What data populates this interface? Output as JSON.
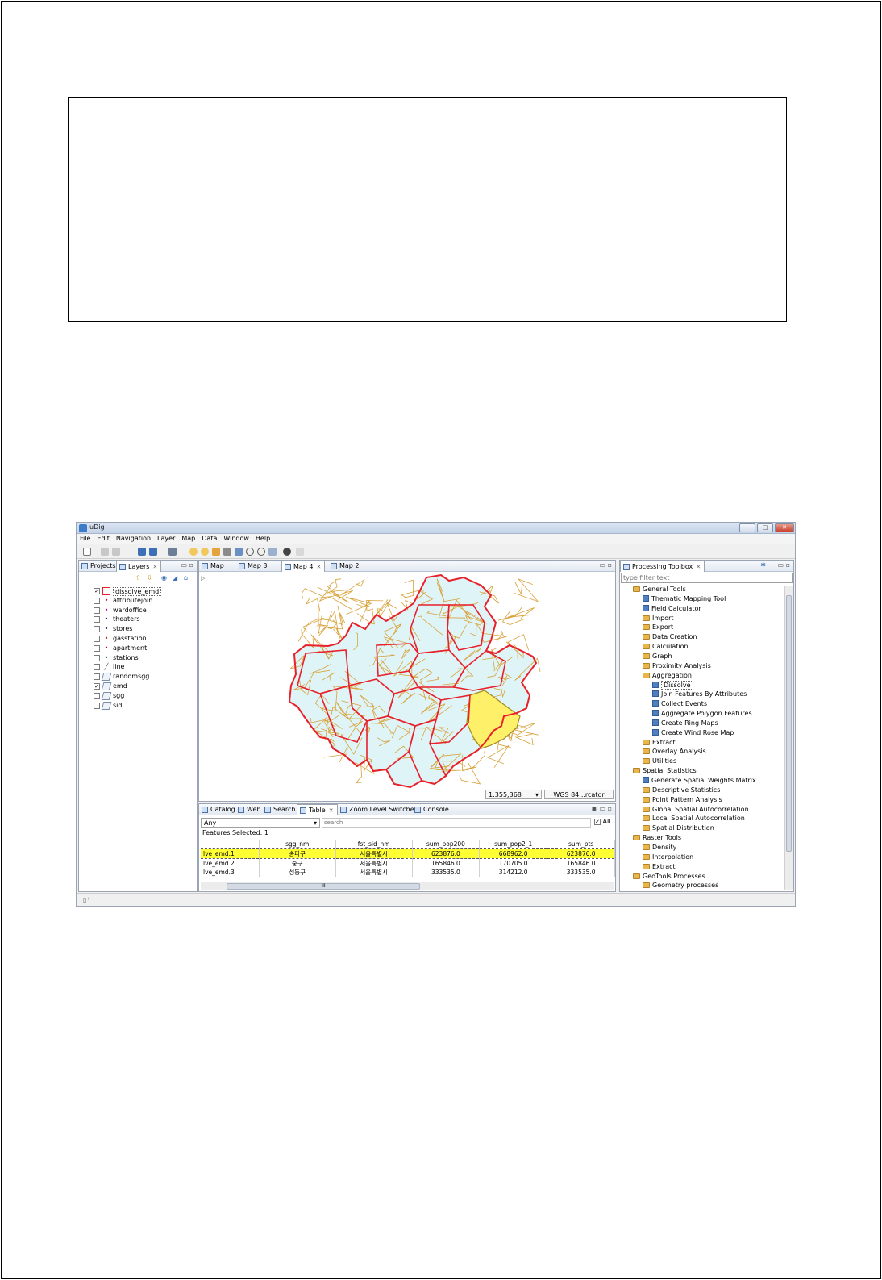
{
  "window": {
    "title": "uDig",
    "minimize": "─",
    "maximize": "□",
    "close": "✕"
  },
  "menu": [
    "File",
    "Edit",
    "Navigation",
    "Layer",
    "Map",
    "Data",
    "Window",
    "Help"
  ],
  "left_panel": {
    "tabs": [
      {
        "label": "Projects",
        "icon": "projects-icon"
      },
      {
        "label": "Layers",
        "icon": "layers-icon"
      }
    ],
    "layers": [
      {
        "name": "dissolve_emd",
        "checked": true,
        "symbol": "polygon-red-icon"
      },
      {
        "name": "attributejoin",
        "checked": false,
        "symbol": "point-icon"
      },
      {
        "name": "wardoffice",
        "checked": false,
        "symbol": "point-icon"
      },
      {
        "name": "theaters",
        "checked": false,
        "symbol": "point-icon"
      },
      {
        "name": "stores",
        "checked": false,
        "symbol": "point-icon"
      },
      {
        "name": "gasstation",
        "checked": false,
        "symbol": "point-icon"
      },
      {
        "name": "apartment",
        "checked": false,
        "symbol": "point-icon"
      },
      {
        "name": "stations",
        "checked": false,
        "symbol": "point-icon"
      },
      {
        "name": "line",
        "checked": false,
        "symbol": "line-icon"
      },
      {
        "name": "randomsgg",
        "checked": false,
        "symbol": "polygon-icon"
      },
      {
        "name": "emd",
        "checked": true,
        "symbol": "polygon-icon"
      },
      {
        "name": "sgg",
        "checked": false,
        "symbol": "polygon-icon"
      },
      {
        "name": "sid",
        "checked": false,
        "symbol": "polygon-icon"
      }
    ]
  },
  "map_editor": {
    "tabs": [
      "Map",
      "Map 3",
      "Map 4",
      "Map 2"
    ],
    "active_tab": "Map 4",
    "scale": "1:355,368",
    "crs": "WGS 84...rcator"
  },
  "bottom_panel": {
    "tabs": [
      "Catalog",
      "Web",
      "Search",
      "Table",
      "Zoom Level Switcher",
      "Console"
    ],
    "active_tab": "Table",
    "filter_select": "Any",
    "search_placeholder": "search",
    "all_label": "All",
    "features_selected": "Features Selected: 1",
    "columns": [
      "",
      "sgg_nm",
      "fst_sid_nm",
      "sum_pop200",
      "sum_pop2_1",
      "sum_pts"
    ],
    "rows": [
      [
        "lve_emd.1",
        "송파구",
        "서울특별시",
        "623876.0",
        "668962.0",
        "623876.0"
      ],
      [
        "lve_emd.2",
        "중구",
        "서울특별시",
        "165846.0",
        "170705.0",
        "165846.0"
      ],
      [
        "lve_emd.3",
        "성동구",
        "서울특별시",
        "333535.0",
        "314212.0",
        "333535.0"
      ]
    ],
    "selected_row": 0,
    "scroll_label": "III"
  },
  "toolbox": {
    "title": "Processing Toolbox",
    "filter_placeholder": "type filter text",
    "items": [
      {
        "label": "General Tools",
        "kind": "folder",
        "level": 1
      },
      {
        "label": "Thematic Mapping Tool",
        "kind": "tool",
        "level": 2
      },
      {
        "label": "Field Calculator",
        "kind": "tool",
        "level": 2
      },
      {
        "label": "Import",
        "kind": "folder",
        "level": 2
      },
      {
        "label": "Export",
        "kind": "folder",
        "level": 2
      },
      {
        "label": "Data Creation",
        "kind": "folder",
        "level": 2
      },
      {
        "label": "Calculation",
        "kind": "folder",
        "level": 2
      },
      {
        "label": "Graph",
        "kind": "folder",
        "level": 2
      },
      {
        "label": "Proximity Analysis",
        "kind": "folder",
        "level": 2
      },
      {
        "label": "Aggregation",
        "kind": "folder",
        "level": 2
      },
      {
        "label": "Dissolve",
        "kind": "tool",
        "level": 3
      },
      {
        "label": "Join Features By Attributes",
        "kind": "tool",
        "level": 3
      },
      {
        "label": "Collect Events",
        "kind": "tool",
        "level": 3
      },
      {
        "label": "Aggregate Polygon Features",
        "kind": "tool",
        "level": 3
      },
      {
        "label": "Create Ring Maps",
        "kind": "tool",
        "level": 3
      },
      {
        "label": "Create Wind Rose Map",
        "kind": "tool",
        "level": 3
      },
      {
        "label": "Extract",
        "kind": "folder",
        "level": 2
      },
      {
        "label": "Overlay Analysis",
        "kind": "folder",
        "level": 2
      },
      {
        "label": "Utilities",
        "kind": "folder",
        "level": 2
      },
      {
        "label": "Spatial Statistics",
        "kind": "folder",
        "level": 1
      },
      {
        "label": "Generate Spatial Weights Matrix",
        "kind": "tool",
        "level": 2
      },
      {
        "label": "Descriptive Statistics",
        "kind": "folder",
        "level": 2
      },
      {
        "label": "Point Pattern Analysis",
        "kind": "folder",
        "level": 2
      },
      {
        "label": "Global Spatial Autocorrelation",
        "kind": "folder",
        "level": 2
      },
      {
        "label": "Local Spatial Autocorrelation",
        "kind": "folder",
        "level": 2
      },
      {
        "label": "Spatial Distribution",
        "kind": "folder",
        "level": 2
      },
      {
        "label": "Raster Tools",
        "kind": "folder",
        "level": 1
      },
      {
        "label": "Density",
        "kind": "folder",
        "level": 2
      },
      {
        "label": "Interpolation",
        "kind": "folder",
        "level": 2
      },
      {
        "label": "Extract",
        "kind": "folder",
        "level": 2
      },
      {
        "label": "GeoTools Processes",
        "kind": "folder",
        "level": 1
      },
      {
        "label": "Geometry processes",
        "kind": "folder",
        "level": 2
      }
    ],
    "selected_item": "Dissolve"
  },
  "colors": {
    "boundary": "#e8202a",
    "subdivision": "#d8a23a",
    "fill": "#dff4f6",
    "selected_fill": "#fff06a",
    "selection_row": "#ffff33"
  }
}
